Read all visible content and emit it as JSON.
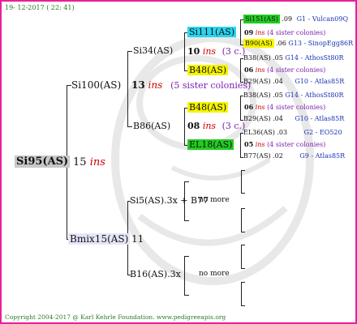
{
  "date": "19- 12-2017 ( 22: 41)",
  "footer": "Copyright 2004-2017 @ Karl Kehrle Foundation.   www.pedigreeapis.org",
  "colors": {
    "frame": "#e8209a",
    "ins": "#cc0000",
    "sister": "#7a1fb0",
    "queen": "#1a33b3",
    "yellow": "#f5f500",
    "cyan": "#29d5ee",
    "green": "#22cc22"
  },
  "root": {
    "name": "Si95(AS)",
    "year": "15",
    "ins": "ins"
  },
  "sire": {
    "name": "Si100(AS)",
    "year": "13",
    "ins": "ins",
    "sisters": "(5 sister colonies)"
  },
  "dam": {
    "name": "Bmix15(AS)",
    "year": "11"
  },
  "g3": {
    "si34": {
      "name": "Si34(AS)",
      "year": "10",
      "ins": "ins",
      "sisters": "(3 c.)"
    },
    "b86": {
      "name": "B86(AS)",
      "year": "08",
      "ins": "ins",
      "sisters": "(3 c.)"
    },
    "si5": {
      "name": "Si5(AS).3x + B77",
      "more": "no more"
    },
    "b16": {
      "name": "B16(AS).3x",
      "more": "no more"
    }
  },
  "g4": {
    "si111": {
      "name": "Si111(AS)",
      "year": "09",
      "ins": "ins",
      "sisters": "(4 sister colonies)"
    },
    "b48a": {
      "name": "B48(AS)",
      "year": "06",
      "ins": "ins",
      "sisters": "(4 sister colonies)"
    },
    "b48b": {
      "name": "B48(AS)",
      "year": "06",
      "ins": "ins",
      "sisters": "(4 sister colonies)"
    },
    "el18": {
      "name": "EL18(AS)",
      "year": "05",
      "ins": "ins",
      "sisters": "(4 sister colonies)"
    }
  },
  "g5": [
    {
      "name": "Si151(AS)",
      "year": ".09",
      "queen": "G1 - Vulcan09Q"
    },
    {
      "name": "B90(AS)",
      "year": ".06",
      "queen": "G13 - SinopEgg86R"
    },
    {
      "name": "B38(AS)",
      "year": ".05",
      "queen": "G14 - AthosSt80R"
    },
    {
      "name": "B29(AS)",
      "year": ".04",
      "queen": "G10 - Atlas85R"
    },
    {
      "name": "B38(AS)",
      "year": ".05",
      "queen": "G14 - AthosSt80R"
    },
    {
      "name": "B29(AS)",
      "year": ".04",
      "queen": "G10 - Atlas85R"
    },
    {
      "name": "EL36(AS)",
      "year": ".03",
      "queen": "G2 - EO520"
    },
    {
      "name": "B77(AS)",
      "year": ".02",
      "queen": "G9 - Atlas85R"
    }
  ]
}
